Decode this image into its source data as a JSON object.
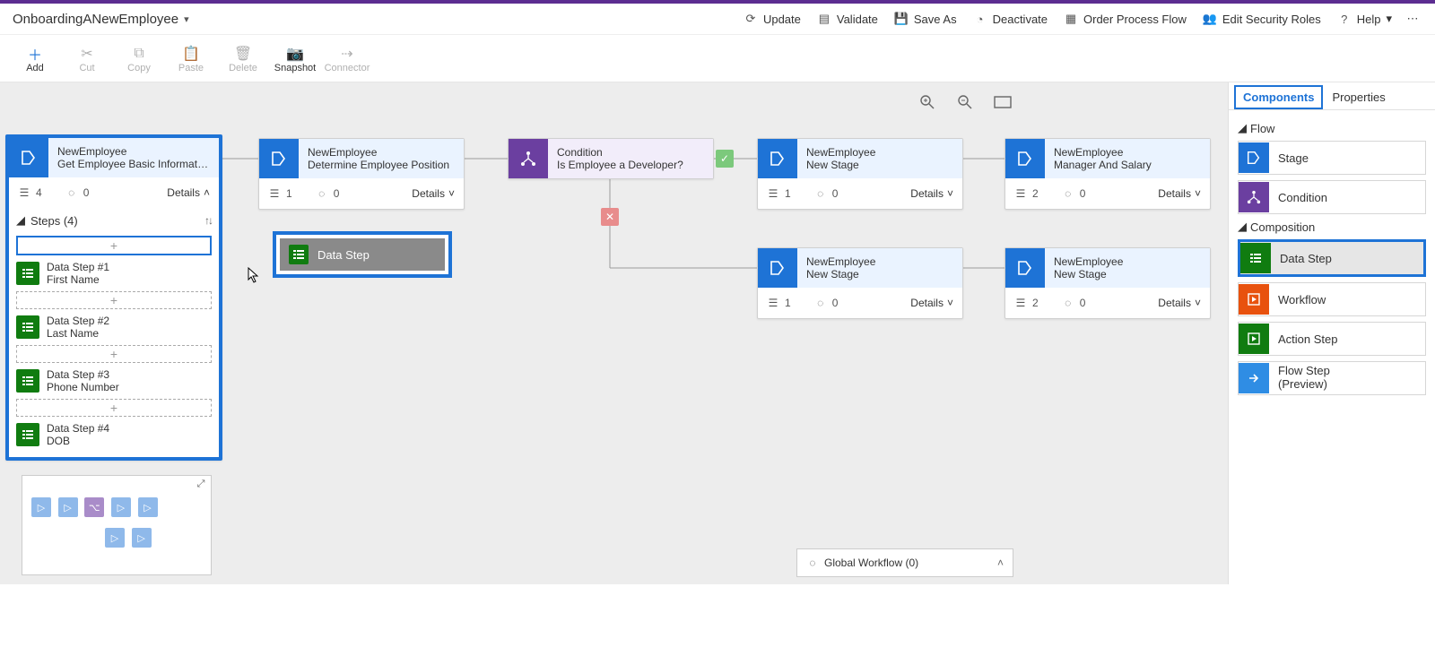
{
  "header": {
    "title": "OnboardingANewEmployee",
    "actions": {
      "update": "Update",
      "validate": "Validate",
      "saveas": "Save As",
      "deactivate": "Deactivate",
      "order": "Order Process Flow",
      "security": "Edit Security Roles",
      "help": "Help"
    }
  },
  "toolbar": {
    "add": "Add",
    "cut": "Cut",
    "copy": "Copy",
    "paste": "Paste",
    "delete": "Delete",
    "snapshot": "Snapshot",
    "connector": "Connector"
  },
  "nodes": {
    "n1": {
      "entity": "NewEmployee",
      "name": "Get Employee Basic Information",
      "steps": "4",
      "triggers": "0",
      "details": "Details"
    },
    "n2": {
      "entity": "NewEmployee",
      "name": "Determine Employee Position",
      "steps": "1",
      "triggers": "0",
      "details": "Details"
    },
    "n3": {
      "entity": "Condition",
      "name": "Is Employee a Developer?"
    },
    "n4": {
      "entity": "NewEmployee",
      "name": "New Stage",
      "steps": "1",
      "triggers": "0",
      "details": "Details"
    },
    "n5": {
      "entity": "NewEmployee",
      "name": "Manager And Salary",
      "steps": "2",
      "triggers": "0",
      "details": "Details"
    },
    "n6": {
      "entity": "NewEmployee",
      "name": "New Stage",
      "steps": "1",
      "triggers": "0",
      "details": "Details"
    },
    "n7": {
      "entity": "NewEmployee",
      "name": "New Stage",
      "steps": "2",
      "triggers": "0",
      "details": "Details"
    }
  },
  "stepsPanel": {
    "header": "Steps (4)",
    "items": [
      {
        "title": "Data Step #1",
        "field": "First Name"
      },
      {
        "title": "Data Step #2",
        "field": "Last Name"
      },
      {
        "title": "Data Step #3",
        "field": "Phone Number"
      },
      {
        "title": "Data Step #4",
        "field": "DOB"
      }
    ]
  },
  "dragGhost": {
    "label": "Data Step"
  },
  "panel": {
    "tabs": {
      "components": "Components",
      "properties": "Properties"
    },
    "flowHeader": "Flow",
    "compositionHeader": "Composition",
    "items": {
      "stage": "Stage",
      "condition": "Condition",
      "datastep": "Data Step",
      "workflow": "Workflow",
      "actionstep": "Action Step",
      "flowstep": "Flow Step\n(Preview)"
    }
  },
  "globalWorkflow": "Global Workflow (0)"
}
